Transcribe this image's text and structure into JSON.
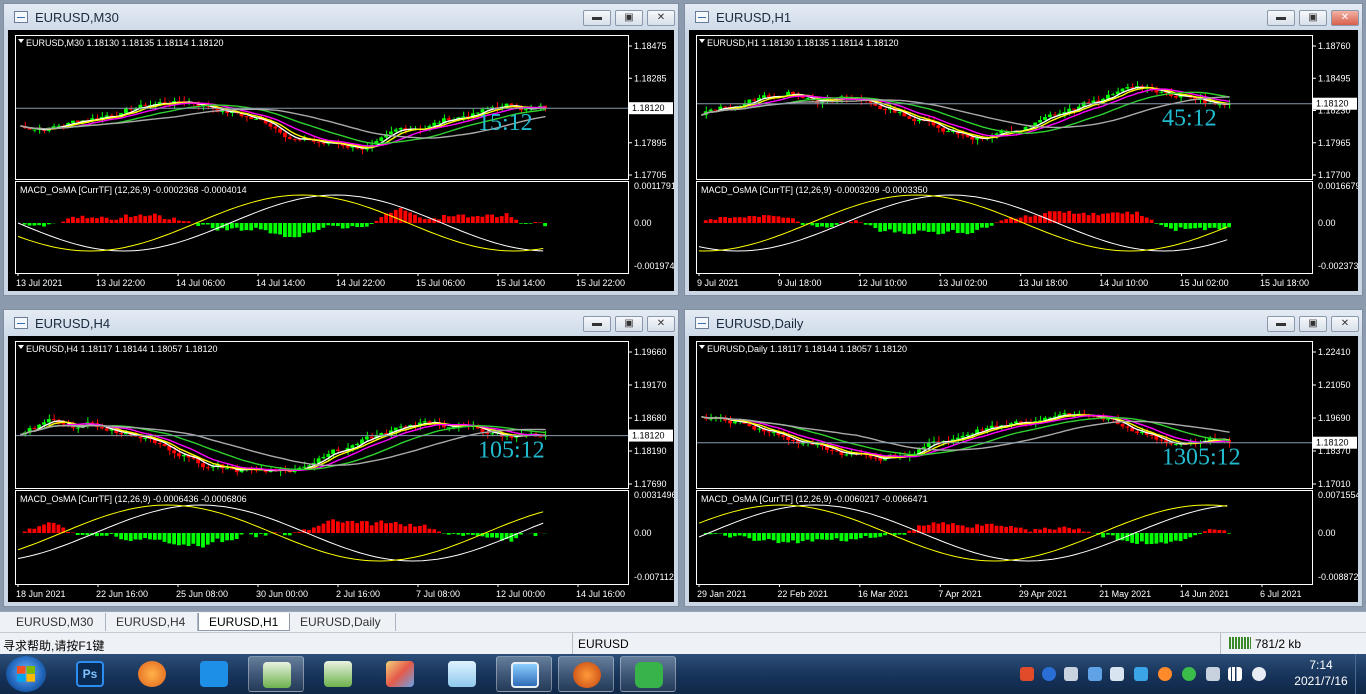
{
  "windows": [
    {
      "id": "m30",
      "title": "EURUSD,M30",
      "header": "EURUSD,M30  1.18130 1.18135 1.18114 1.18120",
      "prices": [
        "1.18475",
        "1.18285",
        "1.18095",
        "1.17895",
        "1.17705"
      ],
      "current_price": "1.18120",
      "countdown": "15:12",
      "indicator_header": "MACD_OsMA [CurrTF] (12,26,9) -0.0002368 -0.0004014",
      "indicator_scale": [
        "0.0011791",
        "0.00",
        "-0.001974"
      ],
      "dates": [
        "13 Jul 2021",
        "13 Jul 22:00",
        "14 Jul 06:00",
        "14 Jul 14:00",
        "14 Jul 22:00",
        "15 Jul 06:00",
        "15 Jul 14:00",
        "15 Jul 22:00"
      ]
    },
    {
      "id": "h1",
      "title": "EURUSD,H1",
      "header": "EURUSD,H1  1.18130 1.18135 1.18114 1.18120",
      "prices": [
        "1.18760",
        "1.18495",
        "1.18230",
        "1.17965",
        "1.17700"
      ],
      "current_price": "1.18120",
      "countdown": "45:12",
      "indicator_header": "MACD_OsMA [CurrTF] (12,26,9) -0.0003209 -0.0003350",
      "indicator_scale": [
        "0.0016679",
        "0.00",
        "-0.002373"
      ],
      "dates": [
        "9 Jul 2021",
        "9 Jul 18:00",
        "12 Jul 10:00",
        "13 Jul 02:00",
        "13 Jul 18:00",
        "14 Jul 10:00",
        "15 Jul 02:00",
        "15 Jul 18:00"
      ]
    },
    {
      "id": "h4",
      "title": "EURUSD,H4",
      "header": "EURUSD,H4  1.18117 1.18144 1.18057 1.18120",
      "prices": [
        "1.19660",
        "1.19170",
        "1.18680",
        "1.18190",
        "1.17690"
      ],
      "current_price": "1.18120",
      "countdown": "105:12",
      "indicator_header": "MACD_OsMA [CurrTF] (12,26,9) -0.0006436 -0.0006806",
      "indicator_scale": [
        "0.0031496",
        "0.00",
        "-0.007112"
      ],
      "dates": [
        "18 Jun 2021",
        "22 Jun 16:00",
        "25 Jun 08:00",
        "30 Jun 00:00",
        "2 Jul 16:00",
        "7 Jul 08:00",
        "12 Jul 00:00",
        "14 Jul 16:00"
      ]
    },
    {
      "id": "d1",
      "title": "EURUSD,Daily",
      "header": "EURUSD,Daily  1.18117 1.18144 1.18057 1.18120",
      "prices": [
        "1.22410",
        "1.21050",
        "1.19690",
        "1.18370",
        "1.17010"
      ],
      "current_price": "1.18120",
      "countdown": "1305:12",
      "indicator_header": "MACD_OsMA [CurrTF] (12,26,9) -0.0060217 -0.0066471",
      "indicator_scale": [
        "0.0071554",
        "0.00",
        "-0.008872"
      ],
      "dates": [
        "29 Jan 2021",
        "22 Feb 2021",
        "16 Mar 2021",
        "7 Apr 2021",
        "29 Apr 2021",
        "21 May 2021",
        "14 Jun 2021",
        "6 Jul 2021"
      ]
    }
  ],
  "tabs": [
    {
      "label": "EURUSD,M30",
      "active": false
    },
    {
      "label": "EURUSD,H4",
      "active": false
    },
    {
      "label": "EURUSD,H1",
      "active": true
    },
    {
      "label": "EURUSD,Daily",
      "active": false
    }
  ],
  "status": {
    "help": "寻求帮助,请按F1键",
    "symbol": "EURUSD",
    "traffic": "781/2 kb"
  },
  "taskbar": {
    "apps": [
      "photoshop-icon",
      "swift-arrow-icon",
      "mountain-app-icon",
      "mt4-active-icon",
      "mt4-icon",
      "paint-icon",
      "notepad-icon",
      "photo-viewer-icon",
      "ninja-icon",
      "wechat-icon"
    ],
    "time": "7:14",
    "date": "2021/7/16"
  },
  "colors": {
    "bull": "#00ff00",
    "bear": "#ff0000",
    "countdown": "#22bcd0",
    "ma_white": "#ffffff",
    "ma_yellow": "#ffff00",
    "ma_magenta": "#ff00ff",
    "ma_green": "#2fd02f",
    "ma_gray": "#a9a9a9"
  }
}
